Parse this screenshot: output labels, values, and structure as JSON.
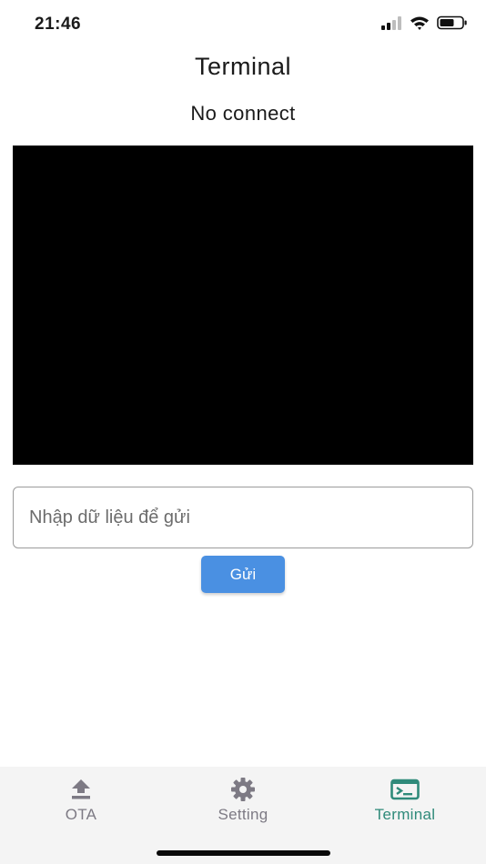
{
  "status_bar": {
    "time": "21:46"
  },
  "header": {
    "title": "Terminal",
    "connection_status": "No connect"
  },
  "terminal": {
    "output": ""
  },
  "input": {
    "value": "",
    "placeholder": "Nhập dữ liệu để gửi"
  },
  "send_button": {
    "label": "Gửi"
  },
  "tabs": [
    {
      "label": "OTA",
      "icon": "upload-icon",
      "active": false
    },
    {
      "label": "Setting",
      "icon": "gear-icon",
      "active": false
    },
    {
      "label": "Terminal",
      "icon": "terminal-icon",
      "active": true
    }
  ],
  "colors": {
    "accent": "#4a90e2",
    "active_tab": "#2f8a7a",
    "inactive_tab": "#7d7a84",
    "terminal_bg": "#000000"
  }
}
